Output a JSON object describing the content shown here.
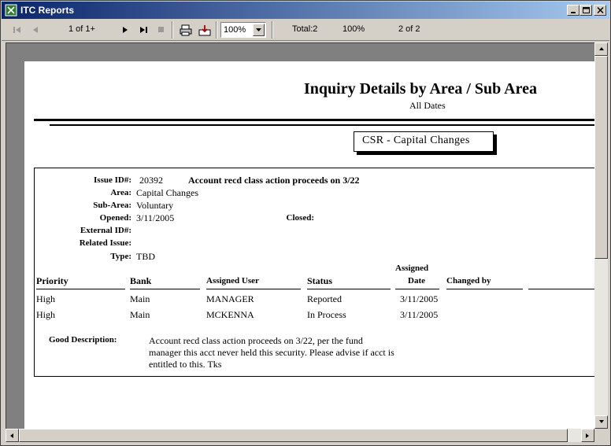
{
  "window": {
    "title": "ITC Reports"
  },
  "toolbar": {
    "page_indicator": "1 of 1+",
    "zoom": "100%",
    "total": "Total:2",
    "percent": "100%",
    "record": "2 of 2"
  },
  "report": {
    "title": "Inquiry Details by Area / Sub Area",
    "subtitle": "All Dates",
    "group_header": "CSR  -  Capital Changes",
    "labels": {
      "issue_id": "Issue ID#:",
      "area": "Area:",
      "sub_area": "Sub-Area:",
      "opened": "Opened:",
      "closed": "Closed:",
      "external_id": "External ID#:",
      "related_issue": "Related Issue:",
      "type": "Type:",
      "good_description": "Good Description:"
    },
    "issue": {
      "id": "20392",
      "summary": "Account recd class action proceeds on 3/22",
      "area": "Capital Changes",
      "sub_area": "Voluntary",
      "opened": "3/11/2005",
      "type": "TBD",
      "description_lines": [
        "Account recd class action proceeds on 3/22, per the fund",
        "manager this acct never held this security.  Please advise if acct is",
        "entitled to this.  Tks"
      ]
    },
    "table": {
      "headers": {
        "priority": "Priority",
        "bank": "Bank",
        "assigned_user": "Assigned User",
        "status": "Status",
        "assigned_date_1": "Assigned",
        "assigned_date_2": "Date",
        "changed_by": "Changed by"
      },
      "rows": [
        {
          "priority": "High",
          "bank": "Main",
          "user": "MANAGER",
          "status": "Reported",
          "date": "3/11/2005",
          "changed_by": ""
        },
        {
          "priority": "High",
          "bank": "Main",
          "user": "MCKENNA",
          "status": "In Process",
          "date": "3/11/2005",
          "changed_by": ""
        }
      ]
    }
  },
  "icons": {
    "app": "report-app-icon",
    "first": "first-page-icon",
    "prev": "previous-page-icon",
    "next": "next-page-icon",
    "last": "last-page-icon",
    "stop": "stop-icon",
    "print": "printer-icon",
    "export": "export-icon"
  }
}
